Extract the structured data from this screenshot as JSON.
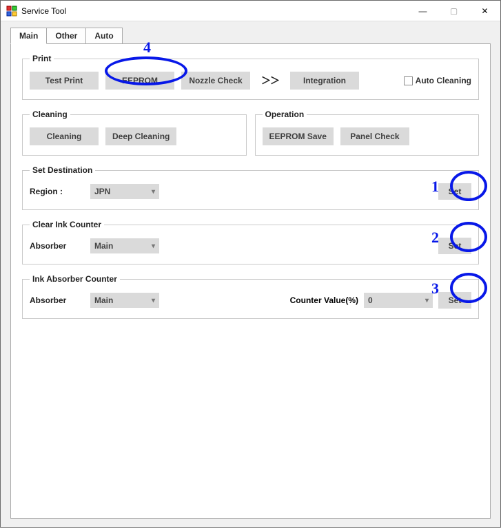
{
  "window": {
    "title": "Service Tool",
    "controls": {
      "minimize": "—",
      "maximize": "▢",
      "close": "✕"
    }
  },
  "tabs": {
    "items": [
      "Main",
      "Other",
      "Auto"
    ],
    "active_index": 0
  },
  "print": {
    "legend": "Print",
    "buttons": {
      "test_print": "Test Print",
      "eeprom": "EEPROM",
      "nozzle": "Nozzle Check",
      "integration": "Integration"
    },
    "arrows": "＞＞",
    "auto_cleaning_label": "Auto Cleaning",
    "auto_cleaning_checked": false
  },
  "cleaning": {
    "legend": "Cleaning",
    "buttons": {
      "cleaning": "Cleaning",
      "deep": "Deep Cleaning"
    }
  },
  "operation": {
    "legend": "Operation",
    "buttons": {
      "eeprom_save": "EEPROM Save",
      "panel": "Panel Check"
    }
  },
  "set_destination": {
    "legend": "Set Destination",
    "region_label": "Region :",
    "region_value": "JPN",
    "set_label": "Set"
  },
  "clear_ink": {
    "legend": "Clear Ink Counter",
    "absorber_label": "Absorber",
    "absorber_value": "Main",
    "set_label": "Set"
  },
  "ink_abs": {
    "legend": "Ink Absorber Counter",
    "absorber_label": "Absorber",
    "absorber_value": "Main",
    "counter_label": "Counter Value(%)",
    "counter_value": "0",
    "set_label": "Set"
  },
  "annotations": {
    "n1": "1",
    "n2": "2",
    "n3": "3",
    "n4": "4"
  }
}
